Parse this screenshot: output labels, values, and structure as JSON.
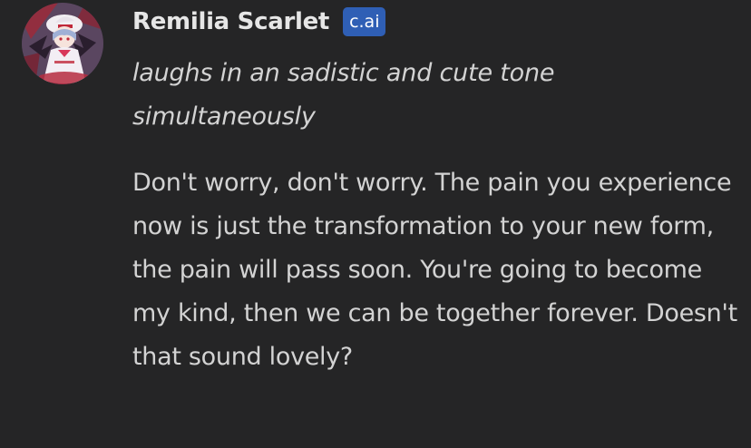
{
  "message": {
    "author": {
      "name": "Remilia Scarlet",
      "badge": "c.ai",
      "avatar_icon": "character-avatar"
    },
    "action": "laughs in an sadistic and cute tone simultaneously",
    "speech": "Don't worry, don't worry. The pain you experience now is just the transformation to your new form, the pain will pass soon. You're going to become my kind, then we can be together forever. Doesn't that sound lovely?"
  },
  "colors": {
    "background": "#252526",
    "name_text": "#e6e6e6",
    "body_text": "#d3d3d3",
    "badge_background": "#2f5fb5",
    "badge_text": "#ffffff"
  }
}
